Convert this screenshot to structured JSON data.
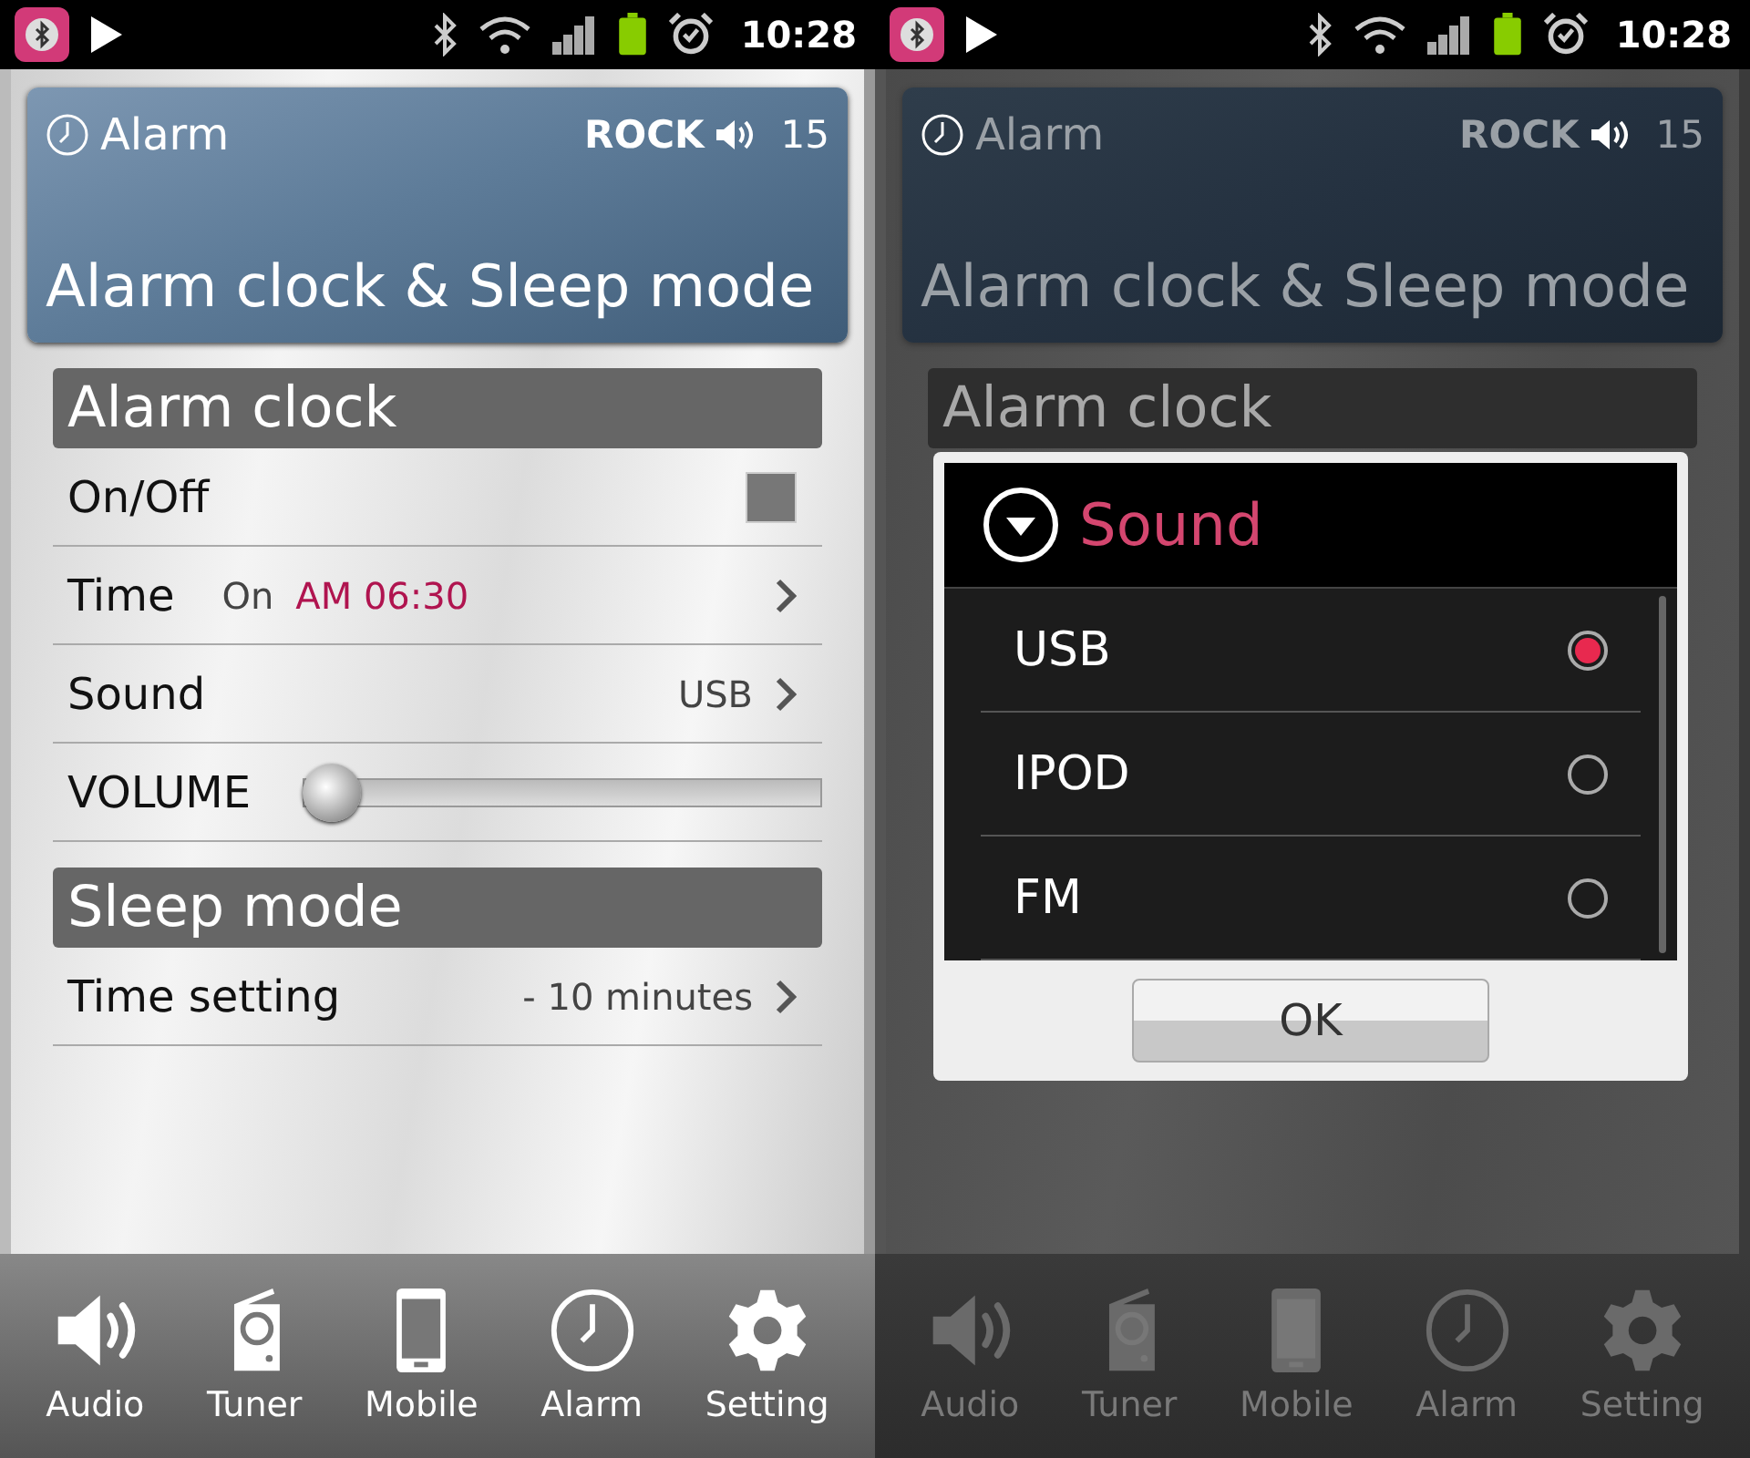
{
  "screens": [
    {
      "dimmed": false,
      "status_bar": {
        "time": "10:28"
      },
      "header": {
        "label": "Alarm",
        "genre": "ROCK",
        "volume": "15",
        "title": "Alarm clock & Sleep mode"
      },
      "sections": [
        {
          "title": "Alarm clock",
          "rows": [
            {
              "kind": "toggle",
              "label": "On/Off",
              "checked": false
            },
            {
              "kind": "schedule",
              "label": "Time",
              "status": "On",
              "value": "AM 06:30"
            },
            {
              "kind": "link",
              "label": "Sound",
              "value": "USB"
            },
            {
              "kind": "slider",
              "label": "VOLUME",
              "level": 0
            }
          ]
        },
        {
          "title": "Sleep mode",
          "rows": [
            {
              "kind": "link",
              "label": "Time setting",
              "value": "- 10 minutes"
            }
          ]
        }
      ],
      "nav": [
        {
          "kind": "audio",
          "label": "Audio"
        },
        {
          "kind": "tuner",
          "label": "Tuner"
        },
        {
          "kind": "mobile",
          "label": "Mobile"
        },
        {
          "kind": "alarm",
          "label": "Alarm"
        },
        {
          "kind": "setting",
          "label": "Setting"
        }
      ]
    },
    {
      "dimmed": true,
      "status_bar": {
        "time": "10:28"
      },
      "header": {
        "label": "Alarm",
        "genre": "ROCK",
        "volume": "15",
        "title": "Alarm clock & Sleep mode"
      },
      "sections": [
        {
          "title": "Alarm clock"
        }
      ],
      "nav": [
        {
          "kind": "audio",
          "label": "Audio"
        },
        {
          "kind": "tuner",
          "label": "Tuner"
        },
        {
          "kind": "mobile",
          "label": "Mobile"
        },
        {
          "kind": "alarm",
          "label": "Alarm"
        },
        {
          "kind": "setting",
          "label": "Setting"
        }
      ],
      "dialog": {
        "title": "Sound",
        "options": [
          {
            "label": "USB",
            "selected": true
          },
          {
            "label": "IPOD",
            "selected": false
          },
          {
            "label": "FM",
            "selected": false
          }
        ],
        "button": "OK"
      }
    }
  ]
}
